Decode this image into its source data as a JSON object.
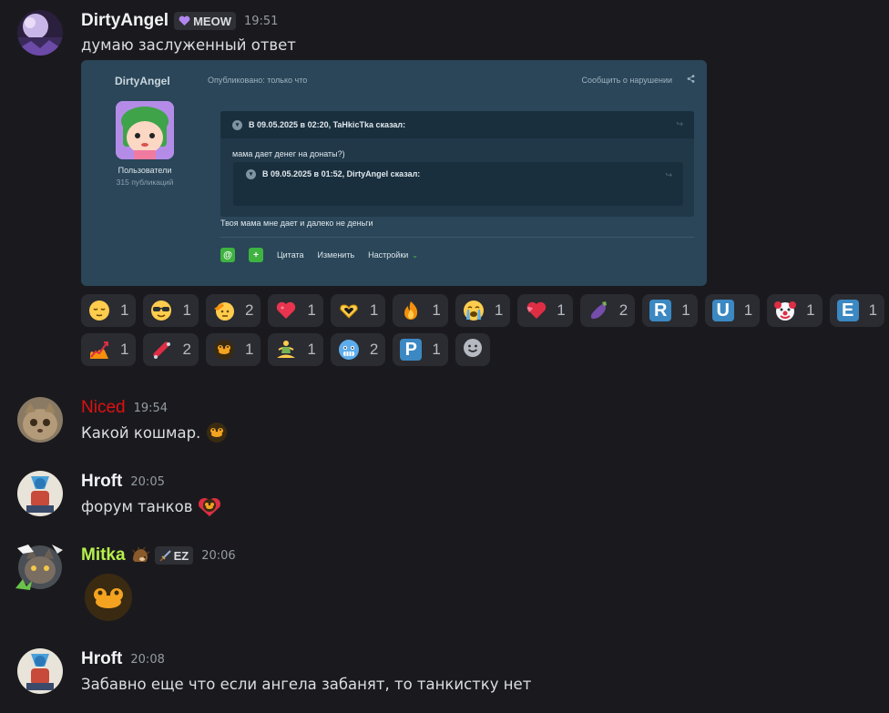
{
  "messages": [
    {
      "username": "DirtyAngel",
      "username_color": "#f2f3f5",
      "tag": "MEOW",
      "time": "19:51",
      "text": "думаю заслуженный ответ"
    },
    {
      "username": "Niced",
      "username_color": "#e01010",
      "time": "19:54",
      "text": "Какой кошмар."
    },
    {
      "username": "Hroft",
      "username_color": "#f2f3f5",
      "time": "20:05",
      "text": "форум танков"
    },
    {
      "username": "Mitka",
      "username_color": "#b6f04a",
      "tag": "EZ",
      "time": "20:06",
      "text": ""
    },
    {
      "username": "Hroft",
      "username_color": "#f2f3f5",
      "time": "20:08",
      "text": "Забавно еще что если ангела забанят, то танкистку нет"
    }
  ],
  "embed": {
    "forum_user": "DirtyAngel",
    "published": "Опубликовано: только что",
    "report": "Сообщить о нарушении",
    "group": "Пользователи",
    "post_count": "315 публикаций",
    "quote_outer_head": "В 09.05.2025 в 02:20, TaHkicTka сказал:",
    "quote_outer_body": "мама дает денег на донаты?)",
    "quote_inner_head": "В 09.05.2025 в 01:52, DirtyAngel сказал:",
    "reply": "Твоя мама мне дает и далеко не деньги",
    "action_quote": "Цитата",
    "action_edit": "Изменить",
    "action_settings": "Настройки"
  },
  "reactions": {
    "row1": [
      {
        "icon": "relieved-face-icon",
        "count": "1"
      },
      {
        "icon": "sunglasses-face-icon",
        "count": "1"
      },
      {
        "icon": "saluting-face-icon",
        "count": "2"
      },
      {
        "icon": "heart-icon",
        "count": "1"
      },
      {
        "icon": "heart-hands-icon",
        "count": "1"
      },
      {
        "icon": "fire-icon",
        "count": "1"
      },
      {
        "icon": "crying-face-icon",
        "count": "1"
      },
      {
        "icon": "heart-with-ribbon-icon",
        "count": "1"
      },
      {
        "icon": "eggplant-icon",
        "count": "2"
      },
      {
        "icon": "letter-r-icon",
        "label": "R",
        "count": "1"
      },
      {
        "icon": "letter-u-icon",
        "label": "U",
        "count": "1"
      },
      {
        "icon": "clown-face-icon",
        "count": "1"
      },
      {
        "icon": "letter-e-icon",
        "label": "E",
        "count": "1"
      }
    ],
    "row2": [
      {
        "icon": "chart-fire-icon",
        "count": "1"
      },
      {
        "icon": "skateboard-icon",
        "count": "2"
      },
      {
        "icon": "duck-emoji-icon",
        "count": "1"
      },
      {
        "icon": "person-lotus-icon",
        "count": "1"
      },
      {
        "icon": "cold-face-icon",
        "count": "2"
      },
      {
        "icon": "letter-p-icon",
        "label": "P",
        "count": "1"
      }
    ]
  },
  "colors": {
    "background": "#1a1a1e",
    "reaction_bg": "#2b2c31",
    "embed_bg": "#2a4658"
  }
}
